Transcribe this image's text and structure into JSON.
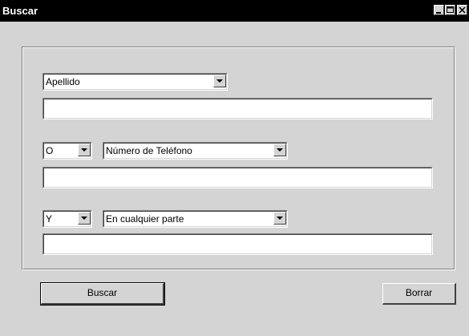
{
  "window": {
    "title": "Buscar",
    "controls": [
      "minimize",
      "maximize",
      "close"
    ]
  },
  "criteria": [
    {
      "field_selector": "Apellido",
      "value": ""
    },
    {
      "operator": "O",
      "field_selector": "Número de Teléfono",
      "value": ""
    },
    {
      "operator": "Y",
      "field_selector": "En cualquier parte",
      "value": ""
    }
  ],
  "buttons": {
    "search_label": "Buscar",
    "clear_label": "Borrar"
  }
}
